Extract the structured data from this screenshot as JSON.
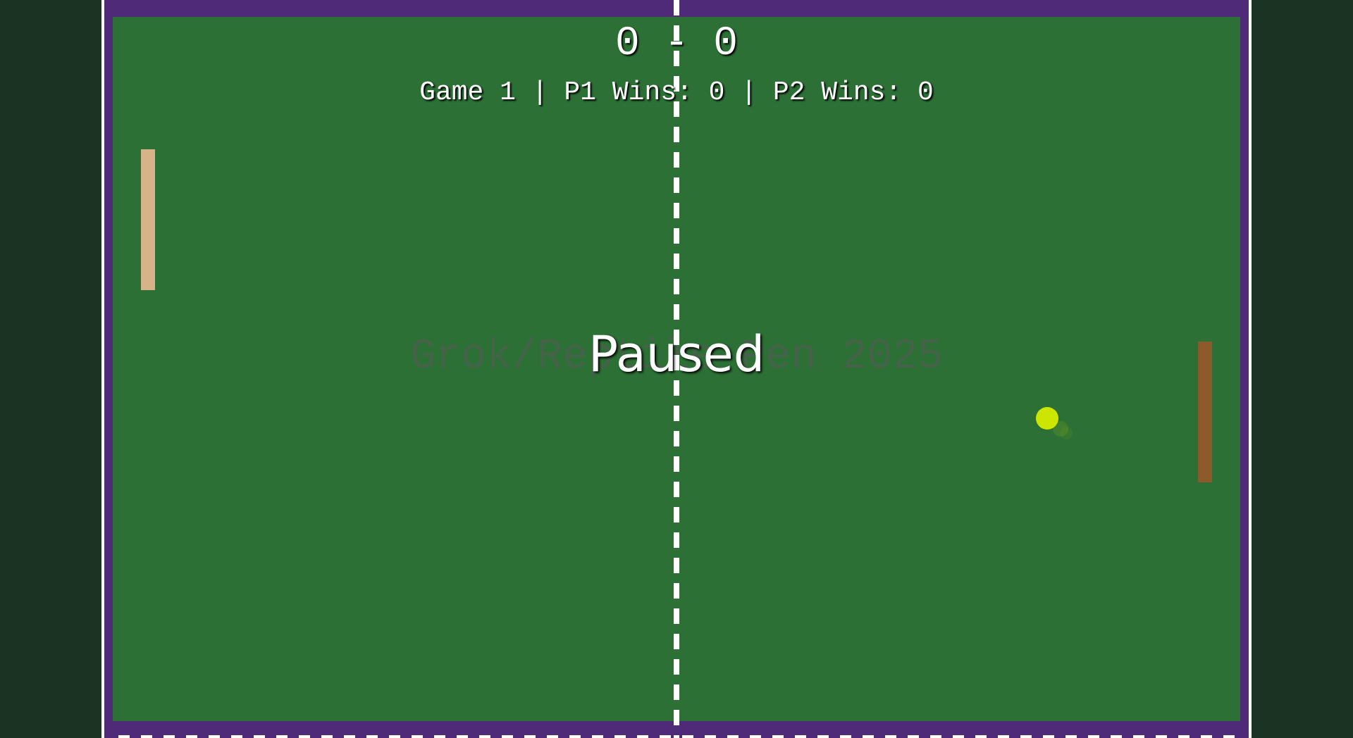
{
  "scoreboard": {
    "text": "0 - 0",
    "stats": "Game 1 | P1 Wins: 0 | P2 Wins: 0"
  },
  "overlay": {
    "status": "Paused",
    "watermark": "Grok/Reptile Pen 2025"
  },
  "colors": {
    "court": "#2c7035",
    "border": "#4f2a78",
    "background": "#1b3322",
    "paddle_left": "#d6b388",
    "paddle_right": "#8d5a2b",
    "ball": "#cde600"
  }
}
